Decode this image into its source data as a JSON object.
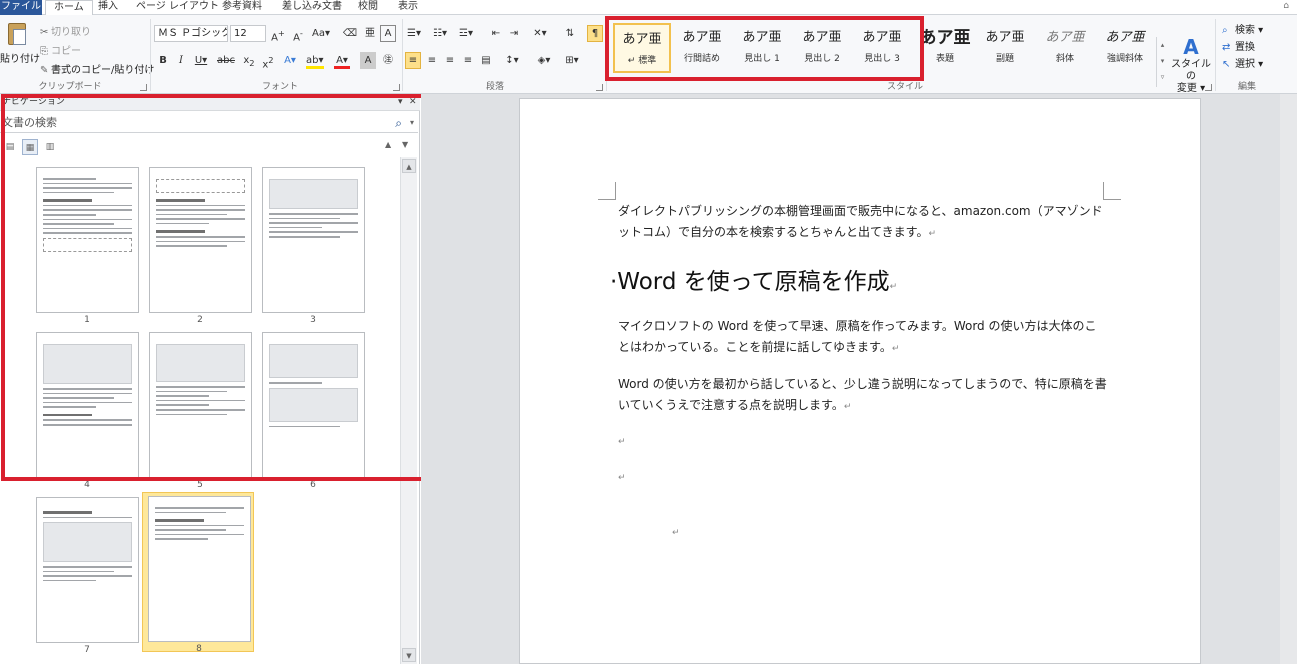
{
  "tabs": [
    "ファイル",
    "ホーム",
    "挿入",
    "ページ レイアウト",
    "参考資料",
    "差し込み文書",
    "校閲",
    "表示"
  ],
  "clipboard": {
    "paste": "貼り付け",
    "cut": "切り取り",
    "copy": "コピー",
    "format_painter": "書式のコピー/貼り付け",
    "label": "クリップボード"
  },
  "font": {
    "name": "ＭＳ Ｐゴシック",
    "size": "12",
    "label": "フォント"
  },
  "paragraph": {
    "label": "段落"
  },
  "styles": {
    "label": "スタイル",
    "items": [
      {
        "sample": "あア亜",
        "name": "↵ 標準"
      },
      {
        "sample": "あア亜",
        "name": "行間詰め"
      },
      {
        "sample": "あア亜",
        "name": "見出し 1"
      },
      {
        "sample": "あア亜",
        "name": "見出し 2"
      },
      {
        "sample": "あア亜",
        "name": "見出し 3"
      },
      {
        "sample": "あア亜",
        "name": "表題"
      },
      {
        "sample": "あア亜",
        "name": "副題"
      },
      {
        "sample": "あア亜",
        "name": "斜体"
      },
      {
        "sample": "あア亜",
        "name": "強調斜体"
      }
    ],
    "change_line1": "スタイルの",
    "change_line2": "変更 ▾"
  },
  "editing": {
    "label": "編集",
    "find": "検索 ▾",
    "replace": "置換",
    "select": "選択 ▾"
  },
  "navigation": {
    "title": "ナビゲーション",
    "search_placeholder": "文書の検索",
    "pages": [
      "1",
      "2",
      "3",
      "4",
      "5",
      "6",
      "7",
      "8"
    ],
    "current_page": "8"
  },
  "document": {
    "para1": "ダイレクトパブリッシングの本棚管理画面で販売中になると、amazon.com（アマゾンドットコム）で自分の本を検索するとちゃんと出てきます。",
    "heading": "·Word を使って原稿を作成",
    "para2": "マイクロソフトの Word を使って早速、原稿を作ってみます。Word の使い方は大体のことはわかっている。ことを前提に話してゆきます。",
    "para3": "Word の使い方を最初から話していると、少し違う説明になってしまうので、特に原稿を書いていくうえで注意する点を説明します。"
  }
}
